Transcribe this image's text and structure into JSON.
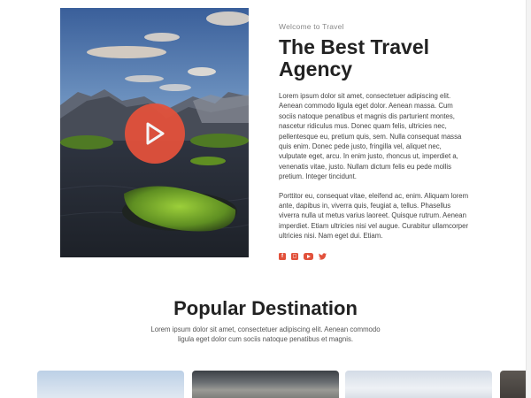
{
  "about": {
    "eyebrow": "Welcome to Travel",
    "title": "The Best Travel Agency",
    "paragraph1": "Lorem ipsum dolor sit amet, consectetuer adipiscing elit. Aenean commodo ligula eget dolor. Aenean massa. Cum sociis natoque penatibus et magnis dis parturient montes, nascetur ridiculus mus. Donec quam felis, ultricies nec, pellentesque eu, pretium quis, sem. Nulla consequat massa quis enim. Donec pede justo, fringilla vel, aliquet nec, vulputate eget, arcu. In enim justo, rhoncus ut, imperdiet a, venenatis vitae, justo. Nullam dictum felis eu pede mollis pretium. Integer tincidunt.",
    "paragraph2": "Porttitor eu, consequat vitae, eleifend ac, enim. Aliquam lorem ante, dapibus in, viverra quis, feugiat a, tellus. Phasellus viverra nulla ut metus varius laoreet. Quisque rutrum. Aenean imperdiet. Etiam ultricies nisi vel augue. Curabitur ullamcorper ultricies nisi. Nam eget dui. Etiam.",
    "social": [
      {
        "icon": "facebook-icon",
        "glyph": "f"
      },
      {
        "icon": "instagram-icon",
        "glyph": "◻"
      },
      {
        "icon": "youtube-icon",
        "glyph": ""
      },
      {
        "icon": "twitter-icon",
        "glyph": "🐦"
      }
    ]
  },
  "hero": {
    "play_icon": "play-icon"
  },
  "destinations": {
    "title": "Popular Destination",
    "subtitle": "Lorem ipsum dolor sit amet, consectetuer adipiscing elit. Aenean commodo ligula eget dolor cum sociis natoque penatibus et magnis."
  },
  "colors": {
    "accent": "#e2513b",
    "heading": "#222222",
    "body_text": "#444444"
  }
}
